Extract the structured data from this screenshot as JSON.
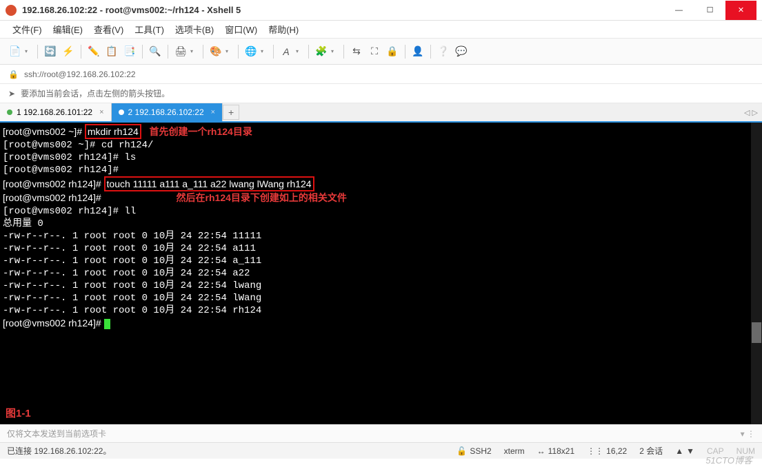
{
  "window": {
    "title": "192.168.26.102:22 - root@vms002:~/rh124 - Xshell 5"
  },
  "menu": {
    "file": "文件(F)",
    "edit": "编辑(E)",
    "view": "查看(V)",
    "tools": "工具(T)",
    "tabs": "选项卡(B)",
    "window": "窗口(W)",
    "help": "帮助(H)"
  },
  "address": {
    "url": "ssh://root@192.168.26.102:22"
  },
  "hint": {
    "text": "要添加当前会话，点击左侧的箭头按钮。"
  },
  "tabs": {
    "tab1": "1 192.168.26.101:22",
    "tab2": "2 192.168.26.102:22",
    "add": "+",
    "nav": "◁ ▷"
  },
  "terminal": {
    "l1_prompt": "[root@vms002 ~]# ",
    "l1_cmd": "mkdir rh124",
    "l1_ann": "   首先创建一个rh124目录",
    "l2": "[root@vms002 ~]# cd rh124/",
    "l3": "[root@vms002 rh124]# ls",
    "l4": "[root@vms002 rh124]#",
    "l5_prompt": "[root@vms002 rh124]# ",
    "l5_cmd": "touch 11111 a111 a_111 a22 lwang lWang rh124",
    "l6": "[root@vms002 rh124]#",
    "l6_ann": "                            然后在rh124目录下创建如上的相关文件",
    "l7": "[root@vms002 rh124]# ll",
    "l8": "总用量 0",
    "l9": "-rw-r--r--. 1 root root 0 10月 24 22:54 11111",
    "l10": "-rw-r--r--. 1 root root 0 10月 24 22:54 a111",
    "l11": "-rw-r--r--. 1 root root 0 10月 24 22:54 a_111",
    "l12": "-rw-r--r--. 1 root root 0 10月 24 22:54 a22",
    "l13": "-rw-r--r--. 1 root root 0 10月 24 22:54 lwang",
    "l14": "-rw-r--r--. 1 root root 0 10月 24 22:54 lWang",
    "l15": "-rw-r--r--. 1 root root 0 10月 24 22:54 rh124",
    "l16": "[root@vms002 rh124]# ",
    "figure": "图1-1"
  },
  "sendbar": {
    "text": "仅将文本发送到当前选项卡"
  },
  "status": {
    "conn": "已连接 192.168.26.102:22。",
    "ssh": "SSH2",
    "term": "xterm",
    "size": "118x21",
    "pos": "16,22",
    "sess": "2 会话",
    "cap": "CAP",
    "num": "NUM"
  },
  "watermark": "51CTO博客"
}
